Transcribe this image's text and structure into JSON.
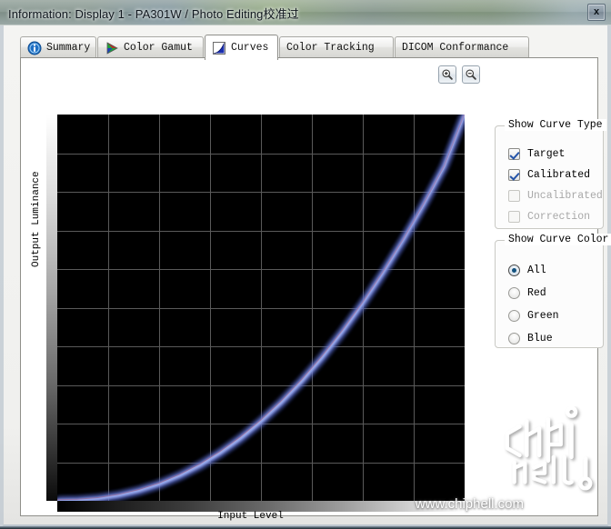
{
  "window": {
    "title": "Information: Display 1 - PA301W / Photo Editing校准过",
    "close_label": "x"
  },
  "tabs": [
    {
      "label": "Summary",
      "icon": "info-icon",
      "active": false
    },
    {
      "label": "Color Gamut",
      "icon": "color-triangle-icon",
      "active": false
    },
    {
      "label": "Curves",
      "icon": "curves-icon",
      "active": true
    },
    {
      "label": "Color Tracking",
      "icon": "none",
      "active": false
    },
    {
      "label": "DICOM Conformance",
      "icon": "none",
      "active": false
    }
  ],
  "toolbar": {
    "zoom_in_label": "zoom-in",
    "zoom_out_label": "zoom-out"
  },
  "panels": {
    "curve_type": {
      "title": "Show Curve Type",
      "options": [
        {
          "label": "Target",
          "checked": true,
          "enabled": true
        },
        {
          "label": "Calibrated",
          "checked": true,
          "enabled": true
        },
        {
          "label": "Uncalibrated",
          "checked": false,
          "enabled": false
        },
        {
          "label": "Correction",
          "checked": false,
          "enabled": false
        }
      ]
    },
    "curve_color": {
      "title": "Show Curve Color",
      "selected": "All",
      "options": [
        {
          "label": "All",
          "checked": true
        },
        {
          "label": "Red",
          "checked": false
        },
        {
          "label": "Green",
          "checked": false
        },
        {
          "label": "Blue",
          "checked": false
        }
      ]
    }
  },
  "watermark": {
    "url": "www.chiphell.com",
    "logo": "chiphell"
  },
  "chart_data": {
    "type": "line",
    "title": "",
    "xlabel": "Input Level",
    "ylabel": "Output Luminance",
    "xlim": [
      0,
      1
    ],
    "ylim": [
      0,
      1
    ],
    "grid": true,
    "grid_x_divisions": 8,
    "grid_y_divisions": 10,
    "legend": "none",
    "background": "#000000",
    "x_gradient": [
      "#000000",
      "#ffffff"
    ],
    "y_gradient": [
      "#ffffff",
      "#000000"
    ],
    "x": [
      0,
      0.05,
      0.1,
      0.15,
      0.2,
      0.25,
      0.3,
      0.35,
      0.4,
      0.45,
      0.5,
      0.55,
      0.6,
      0.65,
      0.7,
      0.75,
      0.8,
      0.85,
      0.9,
      0.95,
      1
    ],
    "series": [
      {
        "name": "Target",
        "color": "#ffffff",
        "gamma": 2.2,
        "values": [
          0,
          0.0012,
          0.0055,
          0.0138,
          0.0263,
          0.0434,
          0.0655,
          0.0927,
          0.1252,
          0.1632,
          0.2067,
          0.2559,
          0.311,
          0.3719,
          0.4388,
          0.5117,
          0.5907,
          0.6758,
          0.7672,
          0.8647,
          1
        ]
      },
      {
        "name": "Calibrated",
        "color": "#8da0e8",
        "gamma": 2.25,
        "values": [
          0,
          0.0011,
          0.0051,
          0.013,
          0.025,
          0.0416,
          0.0632,
          0.0899,
          0.122,
          0.1596,
          0.2029,
          0.252,
          0.3071,
          0.3682,
          0.4355,
          0.509,
          0.5888,
          0.6749,
          0.7675,
          0.8663,
          1
        ]
      }
    ]
  }
}
